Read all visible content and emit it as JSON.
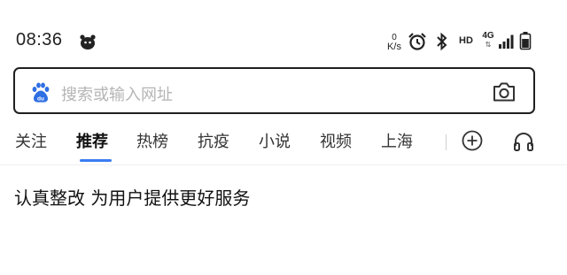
{
  "status_bar": {
    "time": "08:36",
    "net_speed_value": "0",
    "net_speed_unit": "K/s",
    "hd_label": "HD",
    "network_type": "4G",
    "network_arrows": "⇅",
    "icons": [
      "app-notification-icon",
      "alarm-icon",
      "bluetooth-icon",
      "signal-icon",
      "battery-icon"
    ]
  },
  "search": {
    "placeholder": "搜索或输入网址",
    "logo_icon": "baidu-paw-icon",
    "camera_icon": "camera-icon"
  },
  "tabs": {
    "items": [
      {
        "label": "关注",
        "active": false
      },
      {
        "label": "推荐",
        "active": true
      },
      {
        "label": "热榜",
        "active": false
      },
      {
        "label": "抗疫",
        "active": false
      },
      {
        "label": "小说",
        "active": false
      },
      {
        "label": "视频",
        "active": false
      },
      {
        "label": "上海",
        "active": false
      }
    ],
    "accent_color": "#3a7cf2",
    "add_icon": "plus-circle-icon",
    "listen_icon": "headphones-icon"
  },
  "notice": {
    "text": "认真整改 为用户提供更好服务"
  }
}
